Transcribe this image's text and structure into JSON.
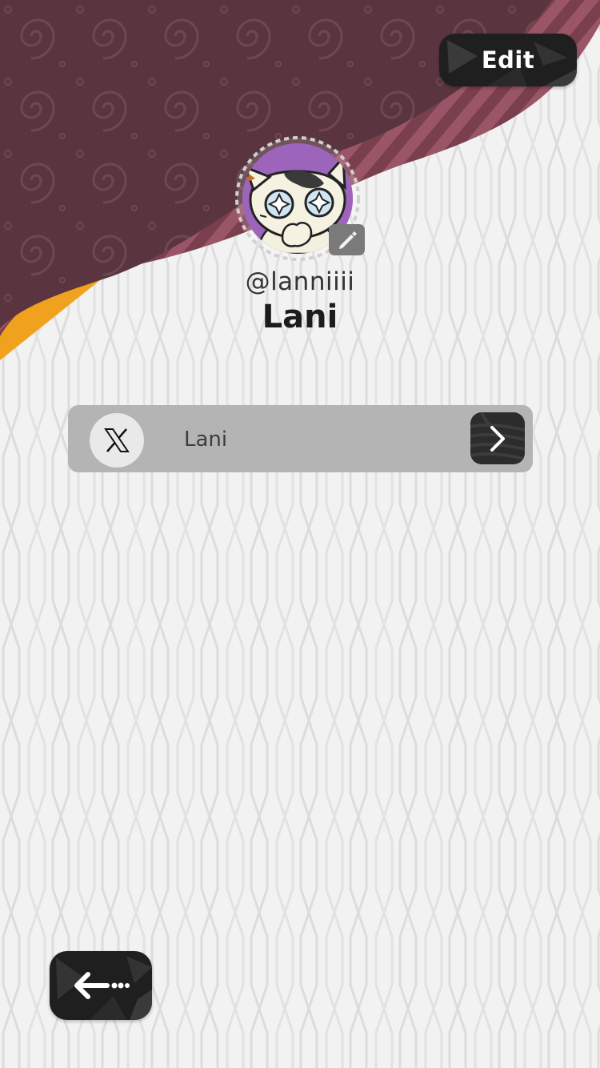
{
  "header": {
    "edit_label": "Edit",
    "icons": [
      "pencil-icon"
    ],
    "colors": {
      "maroon": "#5b3540",
      "stripe": "#8a4d5b",
      "orange": "#f0a020"
    }
  },
  "profile": {
    "handle": "@lanniiii",
    "name": "Lani"
  },
  "social_links": [
    {
      "platform_icon": "x-logo-icon",
      "label": "Lani",
      "action_icon": "chevron-right-icon"
    }
  ],
  "footer": {
    "back_icon": "back-arrow-icon"
  }
}
